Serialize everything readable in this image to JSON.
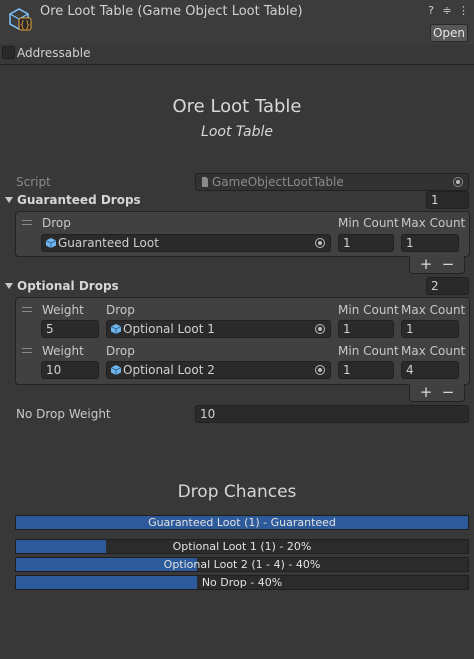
{
  "header": {
    "title": "Ore Loot Table (Game Object Loot Table)",
    "open_label": "Open",
    "icons": [
      "help-icon",
      "preset-icon",
      "menu-icon"
    ]
  },
  "addressable": {
    "label": "Addressable",
    "checked": false
  },
  "inspector": {
    "title": "Ore Loot Table",
    "subtitle": "Loot Table",
    "script_label": "Script",
    "script_value": "GameObjectLootTable",
    "guaranteed": {
      "label": "Guaranteed Drops",
      "count": "1",
      "headers": {
        "drop": "Drop",
        "min": "Min Count",
        "max": "Max Count"
      },
      "items": [
        {
          "drop": "Guaranteed Loot",
          "min": "1",
          "max": "1"
        }
      ]
    },
    "optional": {
      "label": "Optional Drops",
      "count": "2",
      "headers": {
        "weight": "Weight",
        "drop": "Drop",
        "min": "Min Count",
        "max": "Max Count"
      },
      "items": [
        {
          "weight": "5",
          "drop": "Optional Loot 1",
          "min": "1",
          "max": "1"
        },
        {
          "weight": "10",
          "drop": "Optional Loot 2",
          "min": "1",
          "max": "4"
        }
      ]
    },
    "add_label": "+",
    "remove_label": "−",
    "no_drop_label": "No Drop Weight",
    "no_drop_value": "10"
  },
  "chances": {
    "title": "Drop Chances",
    "bars": [
      {
        "label": "Guaranteed Loot (1) - Guaranteed",
        "fraction": 1.0
      },
      {
        "label": "Optional Loot 1 (1) - 20%",
        "fraction": 0.2
      },
      {
        "label": "Optional Loot 2 (1 - 4) - 40%",
        "fraction": 0.4
      },
      {
        "label": "No Drop - 40%",
        "fraction": 0.4
      }
    ]
  },
  "colors": {
    "accent": "#2c5a9a",
    "background": "#383838"
  }
}
